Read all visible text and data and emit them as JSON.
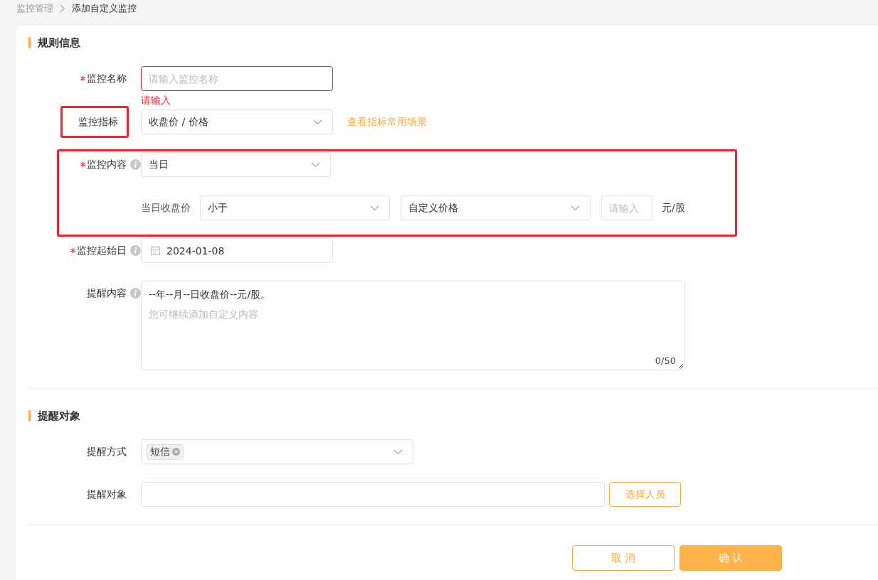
{
  "breadcrumb": [
    {
      "label": "监控管理",
      "current": false
    },
    {
      "label": "添加自定义监控",
      "current": true
    }
  ],
  "rule_section": {
    "title": "规则信息",
    "fields": [
      {
        "kind": "text",
        "label": "监控名称",
        "required": true,
        "placeholder": "请输入监控名称",
        "error": "请输入"
      },
      {
        "kind": "select",
        "label": "监控指标",
        "required": false,
        "highlighted": true,
        "value": "收盘价 / 价格",
        "link": "查看指标常用场景"
      },
      {
        "kind": "content",
        "label": "监控内容",
        "required": true,
        "info": true,
        "highlighted": true,
        "value": "当日",
        "condition": {
          "label": "当日收盘价",
          "operator": "小于",
          "source": "自定义价格",
          "amount_placeholder": "请输入",
          "unit": "元/股"
        }
      },
      {
        "kind": "date",
        "label": "监控起始日",
        "required": true,
        "info": true,
        "value": "2024-01-08"
      },
      {
        "kind": "textarea",
        "label": "提醒内容",
        "required": false,
        "info": true,
        "value": "--年--月--日收盘价--元/股。",
        "placeholder": "您可继续添加自定义内容",
        "counter": "0/50"
      }
    ]
  },
  "notify_section": {
    "title": "提醒对象",
    "fields": [
      {
        "kind": "tags",
        "label": "提醒方式",
        "tags": [
          "短信"
        ]
      },
      {
        "kind": "picker",
        "label": "提醒对象",
        "button": "选择人员"
      }
    ]
  },
  "buttons": [
    {
      "label": "取 消",
      "kind": "secondary"
    },
    {
      "label": "确 认",
      "kind": "primary"
    }
  ]
}
